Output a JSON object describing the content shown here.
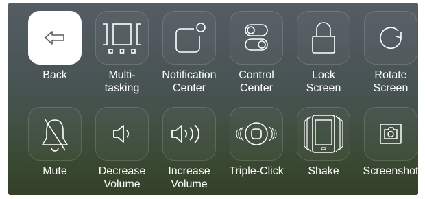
{
  "grid": {
    "items": [
      {
        "label": "Back",
        "icon": "back-arrow-icon",
        "selected": true
      },
      {
        "label": "Multi-\ntasking",
        "icon": "multitasking-icon"
      },
      {
        "label": "Notification\nCenter",
        "icon": "notification-center-icon"
      },
      {
        "label": "Control\nCenter",
        "icon": "control-center-icon"
      },
      {
        "label": "Lock\nScreen",
        "icon": "padlock-icon"
      },
      {
        "label": "Rotate\nScreen",
        "icon": "rotate-icon"
      },
      {
        "label": "Mute",
        "icon": "bell-muted-icon"
      },
      {
        "label": "Decrease\nVolume",
        "icon": "volume-down-icon"
      },
      {
        "label": "Increase\nVolume",
        "icon": "volume-up-icon"
      },
      {
        "label": "Triple-Click",
        "icon": "home-button-icon"
      },
      {
        "label": "Shake",
        "icon": "shake-device-icon"
      },
      {
        "label": "Screenshot",
        "icon": "camera-icon"
      }
    ]
  },
  "colors": {
    "tile_border": "#ffffff24",
    "icon_stroke": "#ffffff",
    "selected_tile": "#ffffff",
    "selected_icon": "#5a5a5a"
  }
}
